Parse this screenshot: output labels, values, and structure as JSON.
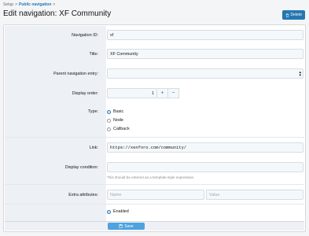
{
  "breadcrumb": {
    "root": "Setup",
    "sep": ">",
    "current": "Public navigation",
    "sep2": ">"
  },
  "page": {
    "title": "Edit navigation: XF Community"
  },
  "actions": {
    "delete_label": "Delete"
  },
  "form": {
    "navigation_id": {
      "label": "Navigation ID:",
      "value": "xf"
    },
    "title": {
      "label": "Title:",
      "value": "XF Community"
    },
    "parent": {
      "label": "Parent navigation entry:",
      "value": ""
    },
    "display_order": {
      "label": "Display order:",
      "value": "1",
      "plus": "+",
      "minus": "−"
    },
    "type": {
      "label": "Type:",
      "options": [
        "Basic",
        "Node",
        "Callback"
      ],
      "selected": "Basic"
    },
    "link": {
      "label": "Link:",
      "value": "https://xenforo.com/community/"
    },
    "display_condition": {
      "label": "Display condition:",
      "value": "",
      "hint": "This should be entered as a template-style expression."
    },
    "extra_attributes": {
      "label": "Extra attributes:",
      "name_placeholder": "Name",
      "value_placeholder": "Value"
    },
    "enabled": {
      "label": "Enabled",
      "checked": true
    },
    "save_label": "Save"
  },
  "colors": {
    "accent": "#2577b1",
    "save": "#4ea2e0",
    "label_bg": "#edf1f6"
  }
}
